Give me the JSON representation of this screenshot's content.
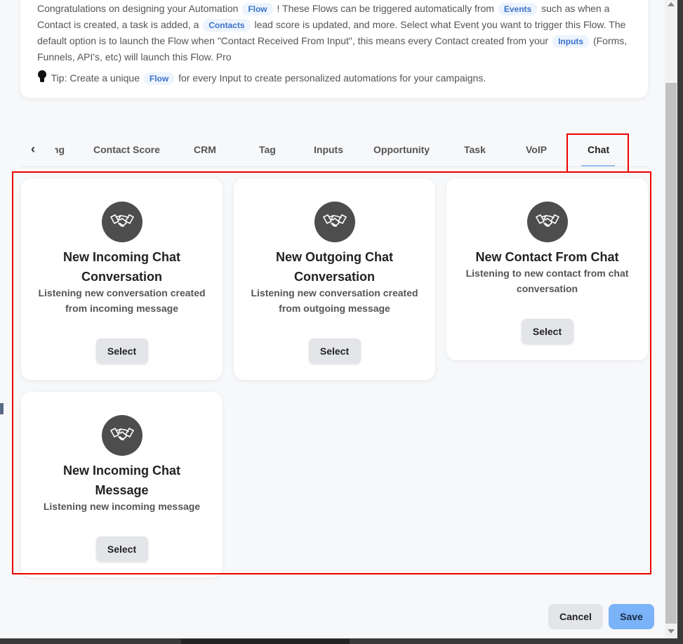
{
  "info": {
    "line1_a": "Congratulations on designing your Automation",
    "line1_pill1": "Flow",
    "line1_b": "! These Flows can be triggered automatically from",
    "line1_pill2": "Events",
    "line1_c": "such as when a",
    "line2_a": "Contact is created, a task is added, a",
    "line2_pill": "Contacts",
    "line2_b": "lead score is updated, and more. Select what Event you want to trigger this Flow. The",
    "line3_a": "default option is to launch the Flow when \"Contact Received From Input\", this means every Contact created from your",
    "line3_pill": "Inputs",
    "line3_b": "(Forms,",
    "line4": "Funnels, API's, etc) will launch this Flow. Pro",
    "tip_a": "Tip: Create a unique",
    "tip_pill": "Flow",
    "tip_b": "for every Input to create personalized automations for your campaigns."
  },
  "tabs": {
    "prev_arrow": "‹",
    "partial": "ng",
    "items": [
      "Contact Score",
      "CRM",
      "Tag",
      "Inputs",
      "Opportunity",
      "Task",
      "VoIP",
      "Chat"
    ],
    "active": "Chat"
  },
  "cards": [
    {
      "title": "New Incoming Chat Conversation",
      "desc": "Listening new conversation created from incoming message",
      "button": "Select",
      "icon": "handshake-icon"
    },
    {
      "title": "New Outgoing Chat Conversation",
      "desc": "Listening new conversation created from outgoing message",
      "button": "Select",
      "icon": "handshake-icon"
    },
    {
      "title": "New Contact From Chat",
      "desc": "Listening to new contact from chat conversation",
      "button": "Select",
      "icon": "handshake-icon"
    },
    {
      "title": "New Incoming Chat Message",
      "desc": "Listening new incoming message",
      "button": "Select",
      "icon": "handshake-icon"
    }
  ],
  "footer": {
    "cancel": "Cancel",
    "save": "Save"
  },
  "colors": {
    "highlight": "#e00000",
    "primary": "#7ab3f7",
    "icon_bg": "#4d4d4d"
  }
}
